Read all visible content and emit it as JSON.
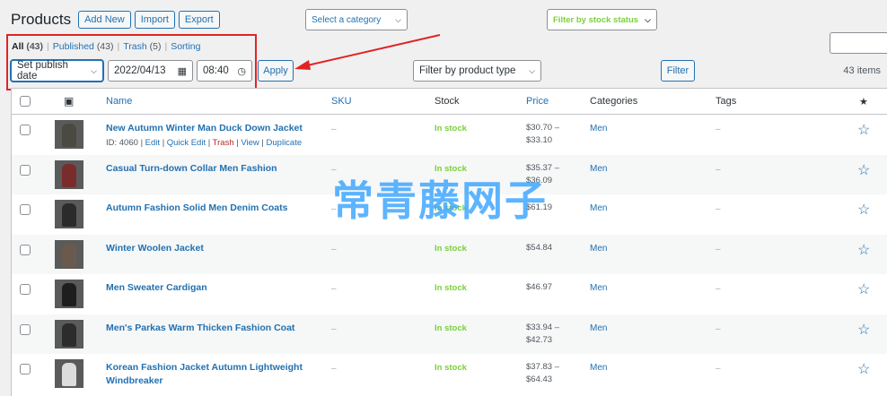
{
  "header": {
    "title": "Products",
    "add_new": "Add New",
    "import": "Import",
    "export": "Export"
  },
  "views": [
    {
      "label": "All",
      "count": "(43)"
    },
    {
      "label": "Published",
      "count": "(43)"
    },
    {
      "label": "Trash",
      "count": "(5)"
    },
    {
      "label": "Sorting",
      "count": ""
    }
  ],
  "view_sep": "|",
  "filters": {
    "publish_date": "Set publish date",
    "date": "2022/04/13",
    "time": "08:40",
    "apply": "Apply",
    "category": "Select a category",
    "product_type": "Filter by product type",
    "stock_status": "Filter by stock status",
    "filter": "Filter",
    "items_count": "43 items"
  },
  "columns": {
    "name": "Name",
    "sku": "SKU",
    "stock": "Stock",
    "price": "Price",
    "categories": "Categories",
    "tags": "Tags",
    "featured": "★"
  },
  "row_actions": {
    "id": "ID: 4060",
    "edit": "Edit",
    "quick_edit": "Quick Edit",
    "trash": "Trash",
    "view": "View",
    "duplicate": "Duplicate",
    "sep": "|"
  },
  "rows": [
    {
      "name": "New Autumn Winter Man Duck Down Jacket",
      "sku": "–",
      "stock": "In stock",
      "price": "$30.70 –\n$33.10",
      "category": "Men",
      "tags": "–",
      "color": "#4b4a40"
    },
    {
      "name": "Casual Turn-down Collar Men Fashion",
      "sku": "–",
      "stock": "In stock",
      "price": "$35.37 –\n$36.09",
      "category": "Men",
      "tags": "–",
      "color": "#7a2c2c"
    },
    {
      "name": "Autumn Fashion Solid Men Denim Coats",
      "sku": "–",
      "stock": "In stock",
      "price": "$61.19",
      "category": "Men",
      "tags": "–",
      "color": "#2b2b2b"
    },
    {
      "name": "Winter Woolen Jacket",
      "sku": "–",
      "stock": "In stock",
      "price": "$54.84",
      "category": "Men",
      "tags": "–",
      "color": "#6a5a4e"
    },
    {
      "name": "Men Sweater Cardigan",
      "sku": "–",
      "stock": "In stock",
      "price": "$46.97",
      "category": "Men",
      "tags": "–",
      "color": "#1e1e1e"
    },
    {
      "name": "Men's Parkas Warm Thicken Fashion Coat",
      "sku": "–",
      "stock": "In stock",
      "price": "$33.94 –\n$42.73",
      "category": "Men",
      "tags": "–",
      "color": "#2c2c2c"
    },
    {
      "name": "Korean Fashion Jacket Autumn Lightweight Windbreaker",
      "sku": "–",
      "stock": "In stock",
      "price": "$37.83 –\n$64.43",
      "category": "Men",
      "tags": "–",
      "color": "#dcdcdc"
    }
  ],
  "watermark": "常青藤网子",
  "colors": {
    "accent": "#2271b1",
    "in_stock": "#7ad03a",
    "highlight": "#e02424",
    "trash": "#b32d2e"
  }
}
